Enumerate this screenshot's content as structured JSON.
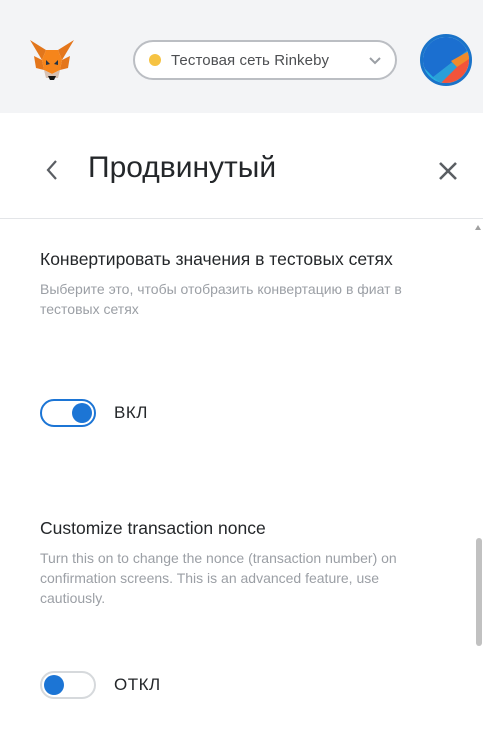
{
  "header": {
    "logo_icon": "metamask-fox-icon",
    "network": {
      "label": "Тестовая сеть Rinkeby",
      "dot_color": "#f6c343"
    },
    "account_icon": "account-avatar-icon"
  },
  "page": {
    "title": "Продвинутый",
    "back_icon": "chevron-left-icon",
    "close_icon": "close-icon"
  },
  "settings": [
    {
      "title": "Конвертировать значения в тестовых сетях",
      "description": "Выберите это, чтобы отобразить конвертацию в фиат в тестовых сетях",
      "toggle_on": true,
      "toggle_label": "ВКЛ"
    },
    {
      "title": "Customize transaction nonce",
      "description": "Turn this on to change the nonce (transaction number) on confirmation screens. This is an advanced feature, use cautiously.",
      "toggle_on": false,
      "toggle_label": "ОТКЛ"
    }
  ],
  "colors": {
    "accent": "#1c75d5",
    "header_bg": "#f3f4f6",
    "muted_text": "#9b9fa5"
  }
}
